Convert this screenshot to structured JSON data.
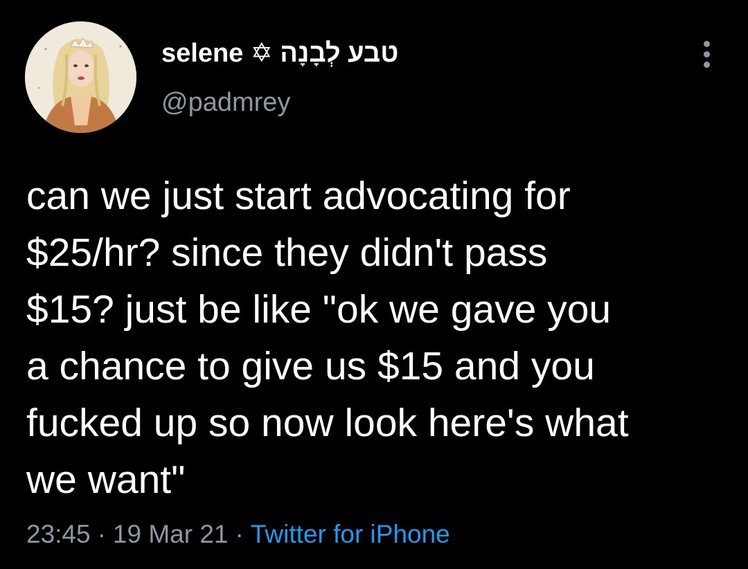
{
  "user": {
    "display_name": "selene ✡ טבע לְבָנָה",
    "handle": "@padmrey",
    "avatar_icon": "profile-avatar"
  },
  "tweet": {
    "text": "can we just start advocating for\n$25/hr? since they didn't pass\n$15? just be like \"ok we gave you\na chance to give us $15 and you\nfucked up so now look here's what\nwe want\""
  },
  "meta": {
    "time": "23:45",
    "separator": "·",
    "date": "19 Mar 21",
    "source": "Twitter for iPhone"
  },
  "colors": {
    "background": "#000000",
    "text": "#ffffff",
    "muted": "#8b98a5",
    "link": "#1d9bf0"
  },
  "icons": {
    "more": "more-vertical-icon"
  }
}
